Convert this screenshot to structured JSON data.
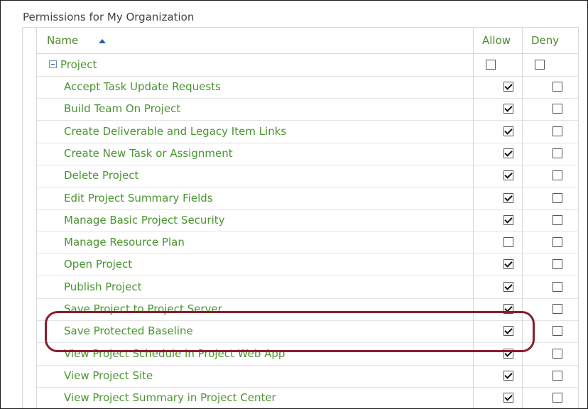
{
  "page_title": "Permissions for My Organization",
  "columns": {
    "name": "Name",
    "allow": "Allow",
    "deny": "Deny"
  },
  "group": {
    "label": "Project",
    "allow": false,
    "deny": false
  },
  "rows": [
    {
      "label": "Accept Task Update Requests",
      "allow": true,
      "deny": false
    },
    {
      "label": "Build Team On Project",
      "allow": true,
      "deny": false
    },
    {
      "label": "Create Deliverable and Legacy Item Links",
      "allow": true,
      "deny": false
    },
    {
      "label": "Create New Task or Assignment",
      "allow": true,
      "deny": false
    },
    {
      "label": "Delete Project",
      "allow": true,
      "deny": false
    },
    {
      "label": "Edit Project Summary Fields",
      "allow": true,
      "deny": false
    },
    {
      "label": "Manage Basic Project Security",
      "allow": true,
      "deny": false
    },
    {
      "label": "Manage Resource Plan",
      "allow": false,
      "deny": false
    },
    {
      "label": "Open Project",
      "allow": true,
      "deny": false
    },
    {
      "label": "Publish Project",
      "allow": true,
      "deny": false
    },
    {
      "label": "Save Project to Project Server",
      "allow": true,
      "deny": false
    },
    {
      "label": "Save Protected Baseline",
      "allow": true,
      "deny": false
    },
    {
      "label": "View Project Schedule in Project Web App",
      "allow": true,
      "deny": false
    },
    {
      "label": "View Project Site",
      "allow": true,
      "deny": false
    },
    {
      "label": "View Project Summary in Project Center",
      "allow": true,
      "deny": false
    }
  ],
  "highlight_color": "#8b1c2c",
  "accent_green": "#4a9430"
}
